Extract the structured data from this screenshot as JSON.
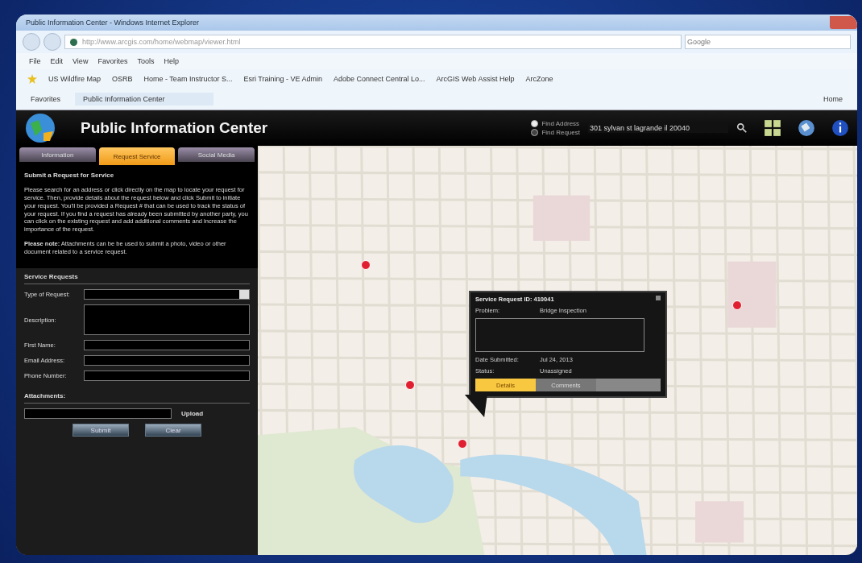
{
  "window": {
    "title": "Public Information Center - Windows Internet Explorer"
  },
  "address_bar": {
    "url": "http://www.arcgis.com/home/webmap/viewer.html",
    "search_placeholder": "Google"
  },
  "menu": [
    "File",
    "Edit",
    "View",
    "Favorites",
    "Tools",
    "Help"
  ],
  "favorites_bar": [
    "US Wildfire Map",
    "OSRB",
    "Home - Team Instructor S...",
    "Esri Training - VE Admin",
    "Adobe Connect Central Lo...",
    "ArcGIS Web Assist Help",
    "ArcZone"
  ],
  "tab_row": {
    "favorites": "Favorites",
    "tab": "Public Information Center",
    "home": "Home"
  },
  "app": {
    "title": "Public Information Center",
    "search_modes": [
      {
        "label": "Find Address",
        "selected": true
      },
      {
        "label": "Find Request",
        "selected": false
      }
    ],
    "search_value": "301 sylvan st lagrande il 20040"
  },
  "panel_tabs": [
    {
      "label": "Information",
      "selected": false
    },
    {
      "label": "Request Service",
      "selected": true
    },
    {
      "label": "Social Media",
      "selected": false
    }
  ],
  "panel": {
    "heading": "Submit a Request for Service",
    "intro": "Please search for an address or click directly on the map to locate your request for service. Then, provide details about the request below and click Submit to initiate your request. You'll be provided a Request # that can be used to track the status of your request. If you find a request has already been submitted by another party, you can click on the existing request and add additional comments and increase the importance of the request.",
    "note": "**Please note:** Attachments can be be used to submit a photo, video or other document related to a service request.",
    "section": "Service Requests",
    "fields": [
      {
        "label": "Type of Request:",
        "kind": "select"
      },
      {
        "label": "Description:",
        "kind": "textarea"
      },
      {
        "label": "First Name:",
        "kind": "text"
      },
      {
        "label": "Email Address:",
        "kind": "text"
      },
      {
        "label": "Phone Number:",
        "kind": "text"
      }
    ],
    "attachments_label": "Attachments:",
    "upload": "Upload",
    "buttons": [
      "Submit",
      "Clear"
    ]
  },
  "popup": {
    "title": "Service Request ID: 410041",
    "rows": [
      {
        "label": "Problem:",
        "value": "Bridge Inspection"
      },
      {
        "label": "Date Submitted:",
        "value": "Jul 24, 2013"
      },
      {
        "label": "Status:",
        "value": "Unassigned"
      }
    ],
    "tabs": [
      {
        "label": "Details",
        "selected": true
      },
      {
        "label": "Comments",
        "selected": false
      }
    ]
  }
}
